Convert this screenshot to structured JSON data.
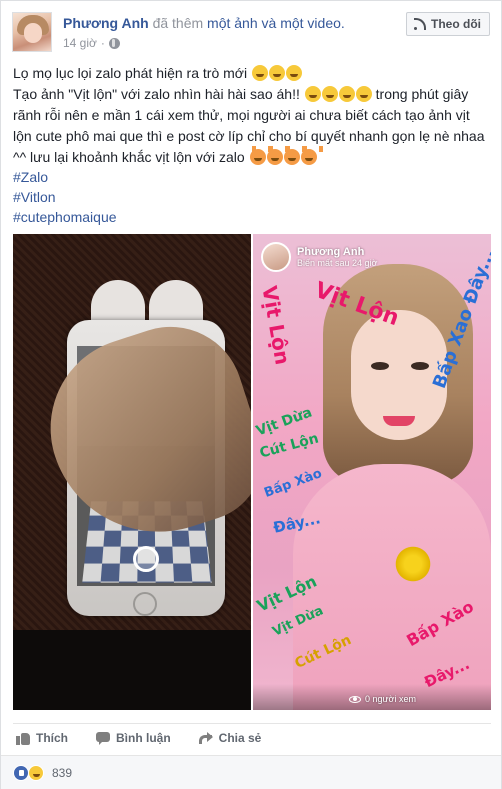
{
  "post": {
    "author": "Phương Anh",
    "action_prefix": "đã thêm",
    "action_link": "một ảnh và một video.",
    "timestamp": "14 giờ",
    "follow_label": "Theo dõi"
  },
  "content": {
    "line1": "Lọ mọ lục lọi zalo phát hiện ra trò mới",
    "line2a": "Tạo ảnh \"Vịt lộn\" với zalo nhìn hài hài sao áh!!",
    "line2b": "trong phút giây rãnh rỗi nên e mần 1 cái xem thử, mọi người ai chưa biết cách tạo ảnh vịt lộn cute phô mai que thì e post cờ líp chỉ cho bí quyết nhanh gọn lẹ nè nhaa ^^ lưu lại khoảnh khắc vịt lộn với zalo",
    "hashtags": [
      "#Zalo",
      "#Vitlon",
      "#cutephomaique"
    ]
  },
  "video": {
    "profile_name": "Phương Anh",
    "profile_sub": "Biến mất sau 24 giờ",
    "viewers": "0 người xem",
    "scribbles": [
      "Vịt Lộn",
      "Vịt Lộn",
      "Vịt Dừa",
      "Cút Lộn",
      "Bấp Xào",
      "Đây...",
      "Vịt Lộn",
      "Vịt Dừa",
      "Cút Lộn",
      "Bấp Xào",
      "Đây...",
      "Bấp Xao Đây..."
    ]
  },
  "actions": {
    "like": "Thích",
    "comment": "Bình luận",
    "share": "Chia sẻ"
  },
  "reactions": {
    "count": "839"
  },
  "colors": {
    "link": "#365899",
    "secondary": "#90949c",
    "like_blue": "#4267b2"
  }
}
